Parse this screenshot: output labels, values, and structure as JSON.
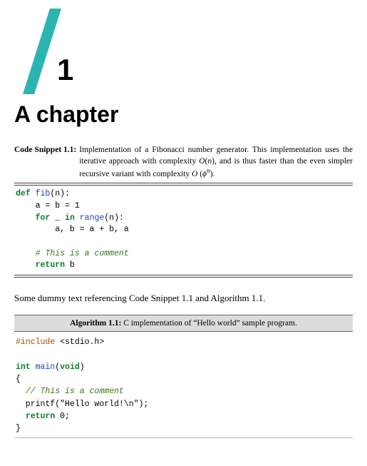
{
  "chapter": {
    "number": "1",
    "title": "A chapter"
  },
  "snippet1": {
    "label": "Code Snippet 1.1:",
    "caption_part1": "Implementation of a Fibonacci number generator. This implementation uses the iterative approach with complexity ",
    "complexity1_pre": "O",
    "complexity1_arg": "n",
    "caption_part2": ", and is thus faster than the even simpler recursive variant with complexity ",
    "complexity2_pre": "O",
    "complexity2_base": "ϕ",
    "complexity2_exp": "n",
    "caption_part3": ".",
    "code": {
      "l1_def": "def",
      "l1_name": "fib",
      "l1_rest": "(n):",
      "l2": "    a = b = 1",
      "l3_for": "for",
      "l3_mid": " _ ",
      "l3_in": "in",
      "l3_sp": " ",
      "l3_range": "range",
      "l3_rest": "(n):",
      "l4": "        a, b = a + b, a",
      "l5": "",
      "l6_indent": "    ",
      "l6_cmt": "# This is a comment",
      "l7_indent": "    ",
      "l7_ret": "return",
      "l7_rest": " b"
    }
  },
  "body_text_pre": "Some dummy text referencing Code Snippet ",
  "body_ref1": "1.1",
  "body_text_mid": " and Algorithm ",
  "body_ref2": "1.1",
  "body_text_post": ".",
  "algo": {
    "label": "Algorithm 1.1:",
    "caption": " C implementation of “Hello world” sample program.",
    "code": {
      "l1_inc": "#include",
      "l1_rest": " <stdio.h>",
      "l2": "",
      "l3_int": "int",
      "l3_sp": " ",
      "l3_main": "main",
      "l3_p1": "(",
      "l3_void": "void",
      "l3_p2": ")",
      "l4": "{",
      "l5_indent": "  ",
      "l5_cmt": "// This is a comment",
      "l6": "  printf(\"Hello world!\\n\");",
      "l7_indent": "  ",
      "l7_ret": "return",
      "l7_rest": " 0;",
      "l8": "}"
    }
  }
}
